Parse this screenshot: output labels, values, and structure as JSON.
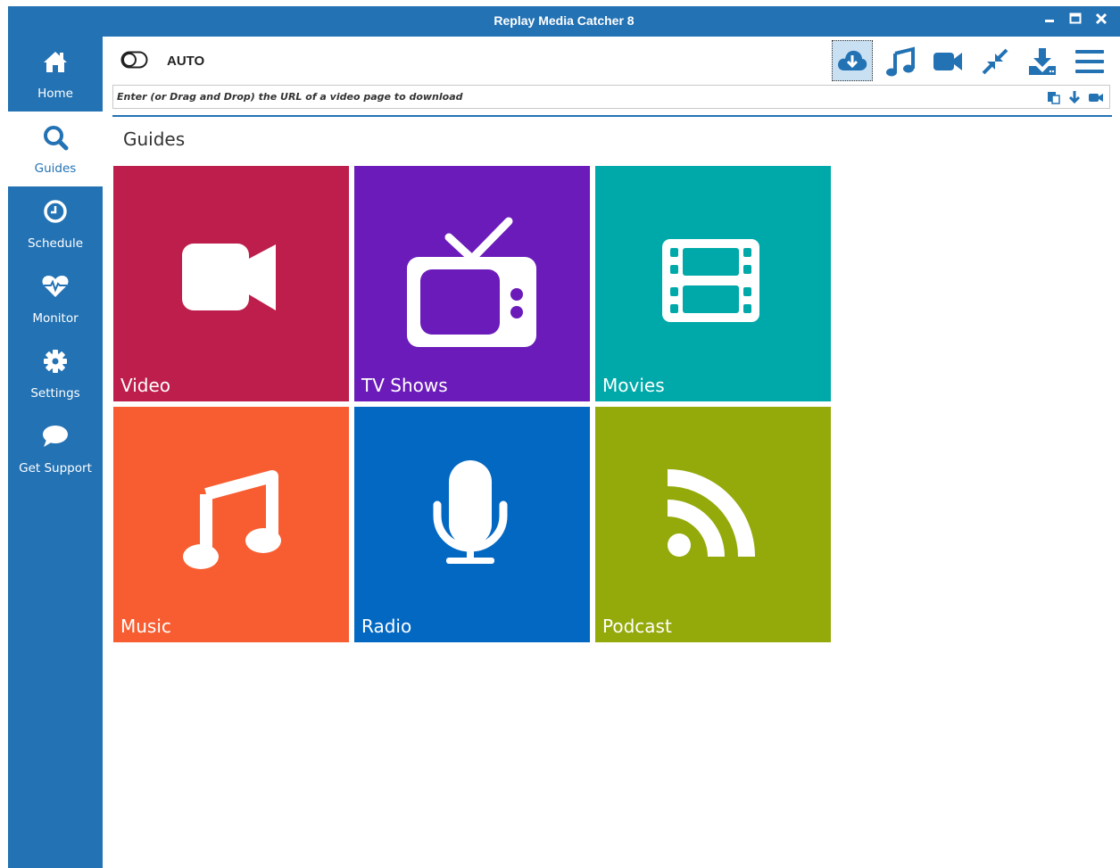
{
  "window": {
    "title": "Replay Media Catcher 8",
    "minimize_icon": "minimize-icon",
    "maximize_icon": "maximize-icon",
    "close_icon": "close-icon"
  },
  "sidebar": {
    "items": [
      {
        "label": "Home",
        "icon": "home-icon"
      },
      {
        "label": "Guides",
        "icon": "search-icon",
        "active": true
      },
      {
        "label": "Schedule",
        "icon": "clock-icon"
      },
      {
        "label": "Monitor",
        "icon": "heartbeat-icon"
      },
      {
        "label": "Settings",
        "icon": "gear-icon"
      },
      {
        "label": "Get Support",
        "icon": "chat-icon"
      }
    ]
  },
  "toolbar": {
    "auto_label": "AUTO",
    "auto_state": "off",
    "tools": [
      "cloud-download-icon",
      "music-note-icon",
      "video-camera-icon",
      "compress-icon",
      "download-icon",
      "menu-icon"
    ],
    "selected_tool": "cloud-download-icon"
  },
  "url": {
    "placeholder": "Enter (or Drag and Drop) the URL of a video page to download",
    "value": "",
    "icons": [
      "paste-icon",
      "arrow-down-icon",
      "video-camera-icon"
    ]
  },
  "main": {
    "title": "Guides",
    "tiles": [
      {
        "label": "Video",
        "color": "#be1e4b",
        "icon": "video-camera-icon"
      },
      {
        "label": "TV Shows",
        "color": "#6a1bb9",
        "icon": "tv-icon"
      },
      {
        "label": "Movies",
        "color": "#00a9a9",
        "icon": "film-icon"
      },
      {
        "label": "Music",
        "color": "#f85d31",
        "icon": "music-note-icon"
      },
      {
        "label": "Radio",
        "color": "#0368c2",
        "icon": "microphone-icon"
      },
      {
        "label": "Podcast",
        "color": "#94aa0a",
        "icon": "rss-icon"
      }
    ]
  },
  "colors": {
    "accent": "#2372b4",
    "background": "#ffffff"
  }
}
